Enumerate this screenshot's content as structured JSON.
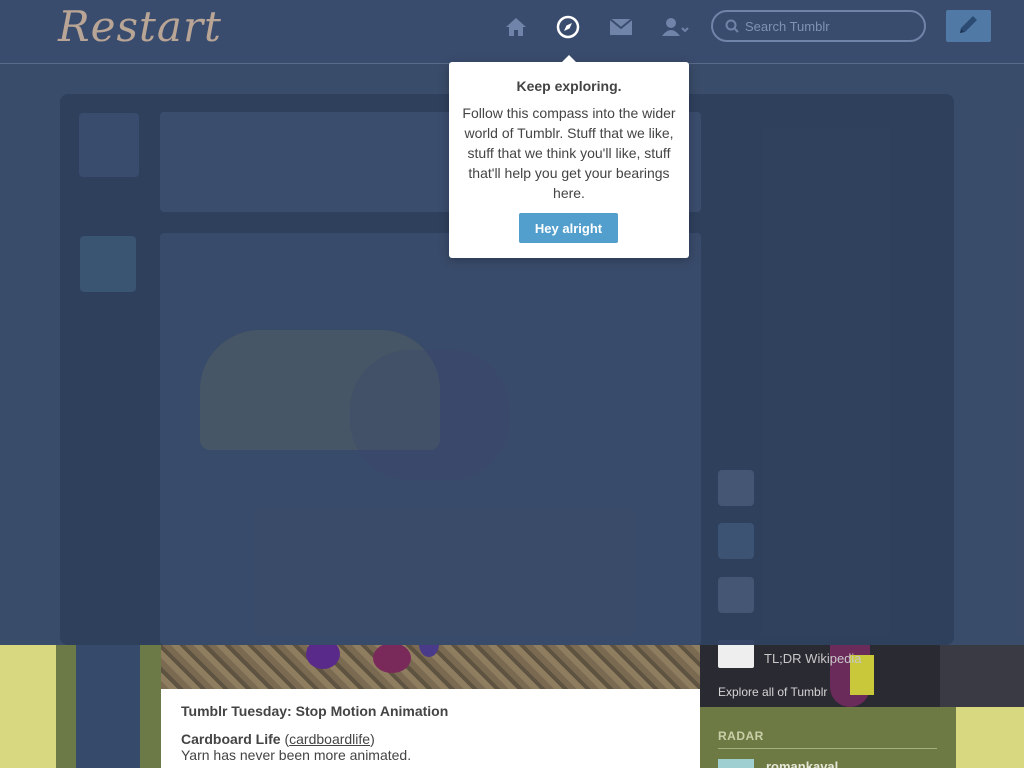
{
  "header": {
    "logo": "Restart",
    "search_placeholder": "Search Tumblr"
  },
  "popover": {
    "title": "Keep exploring.",
    "body": "Follow this compass into the wider world of Tumblr. Stuff that we like, stuff that we think you'll like, stuff that'll help you get your bearings here.",
    "button": "Hey alright"
  },
  "post": {
    "title": "Tumblr Tuesday: Stop Motion Animation",
    "author_name": "Cardboard Life",
    "author_handle": "cardboardlife",
    "paren_open": "(",
    "paren_close": ")",
    "description": "Yarn has never been more animated."
  },
  "sidebar": {
    "wiki_name": "TL;DR Wikipedia",
    "explore_link": "Explore all of Tumblr",
    "radar_title": "RADAR",
    "radar_user": "romankaval"
  },
  "colors": {
    "overlay": "#36486c",
    "accent": "#529ecc",
    "yellow": "#d7d87f"
  }
}
